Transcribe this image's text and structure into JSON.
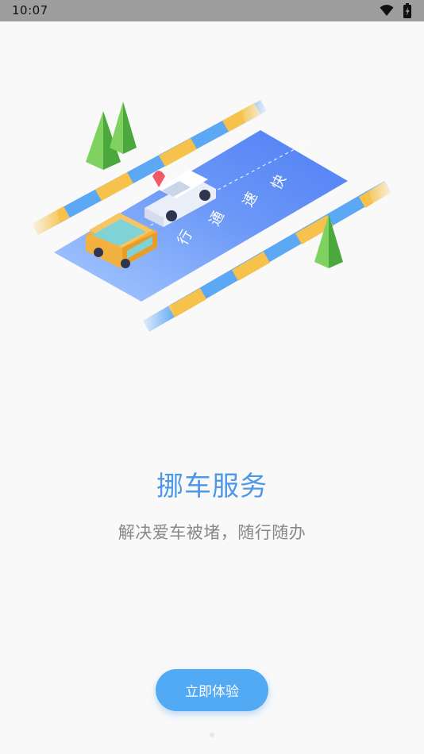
{
  "status_bar": {
    "time": "10:07",
    "icons": [
      "wifi-icon",
      "battery-icon"
    ]
  },
  "illustration": {
    "road_text": [
      "快",
      "速",
      "通",
      "行"
    ],
    "colors": {
      "road": "#5c8cf7",
      "road_light": "#9cc1ff",
      "stripe_blue": "#5da8f5",
      "stripe_yellow": "#f6c24c",
      "tree": "#5bbf4a"
    }
  },
  "onboarding": {
    "title": "挪车服务",
    "subtitle": "解决爱车被堵，随行随办",
    "cta_label": "立即体验"
  },
  "pager": {
    "count": 3,
    "active": 0
  },
  "colors": {
    "accent": "#4c97e6",
    "button": "#52a9f4",
    "subtitle": "#888888"
  }
}
